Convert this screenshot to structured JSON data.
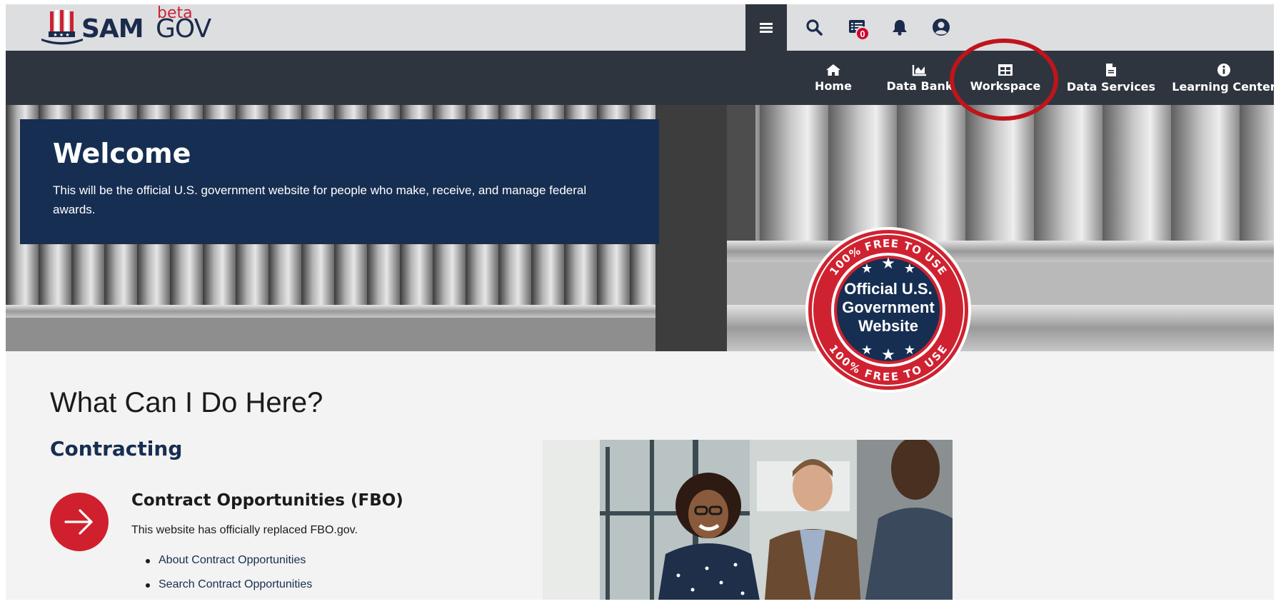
{
  "header": {
    "logo": {
      "brand": "SAM",
      "suffix": "GOV",
      "tag": "beta"
    },
    "menu_icon": "hamburger-icon",
    "search_icon": "search-icon",
    "messages": {
      "icon": "messages-icon",
      "count": "0"
    },
    "notifications_icon": "bell-icon",
    "profile_icon": "user-circle-icon"
  },
  "nav": {
    "items": [
      {
        "label": "Home",
        "icon": "home-icon"
      },
      {
        "label": "Data Bank",
        "icon": "chart-icon"
      },
      {
        "label": "Workspace",
        "icon": "workspace-icon",
        "highlighted": true
      },
      {
        "label": "Data Services",
        "icon": "document-icon"
      },
      {
        "label": "Learning Center",
        "icon": "info-icon"
      }
    ],
    "highlight_color": "#c0141b"
  },
  "hero": {
    "title": "Welcome",
    "text": "This will be the official U.S. government website for people who make, receive, and manage federal awards."
  },
  "seal": {
    "top_text": "100% FREE TO USE",
    "line1": "Official U.S.",
    "line2": "Government",
    "line3": "Website",
    "bottom_text": "100% FREE TO USE"
  },
  "content": {
    "heading": "What Can I Do Here?",
    "section": "Contracting",
    "feature": {
      "title": "Contract Opportunities (FBO)",
      "description": "This website has officially replaced FBO.gov.",
      "links": [
        "About Contract Opportunities",
        "Search Contract Opportunities"
      ]
    }
  },
  "colors": {
    "navy": "#162e51",
    "nav_bg": "#2e353f",
    "accent_red": "#d0202e",
    "topbar_bg": "#dcdee0"
  }
}
